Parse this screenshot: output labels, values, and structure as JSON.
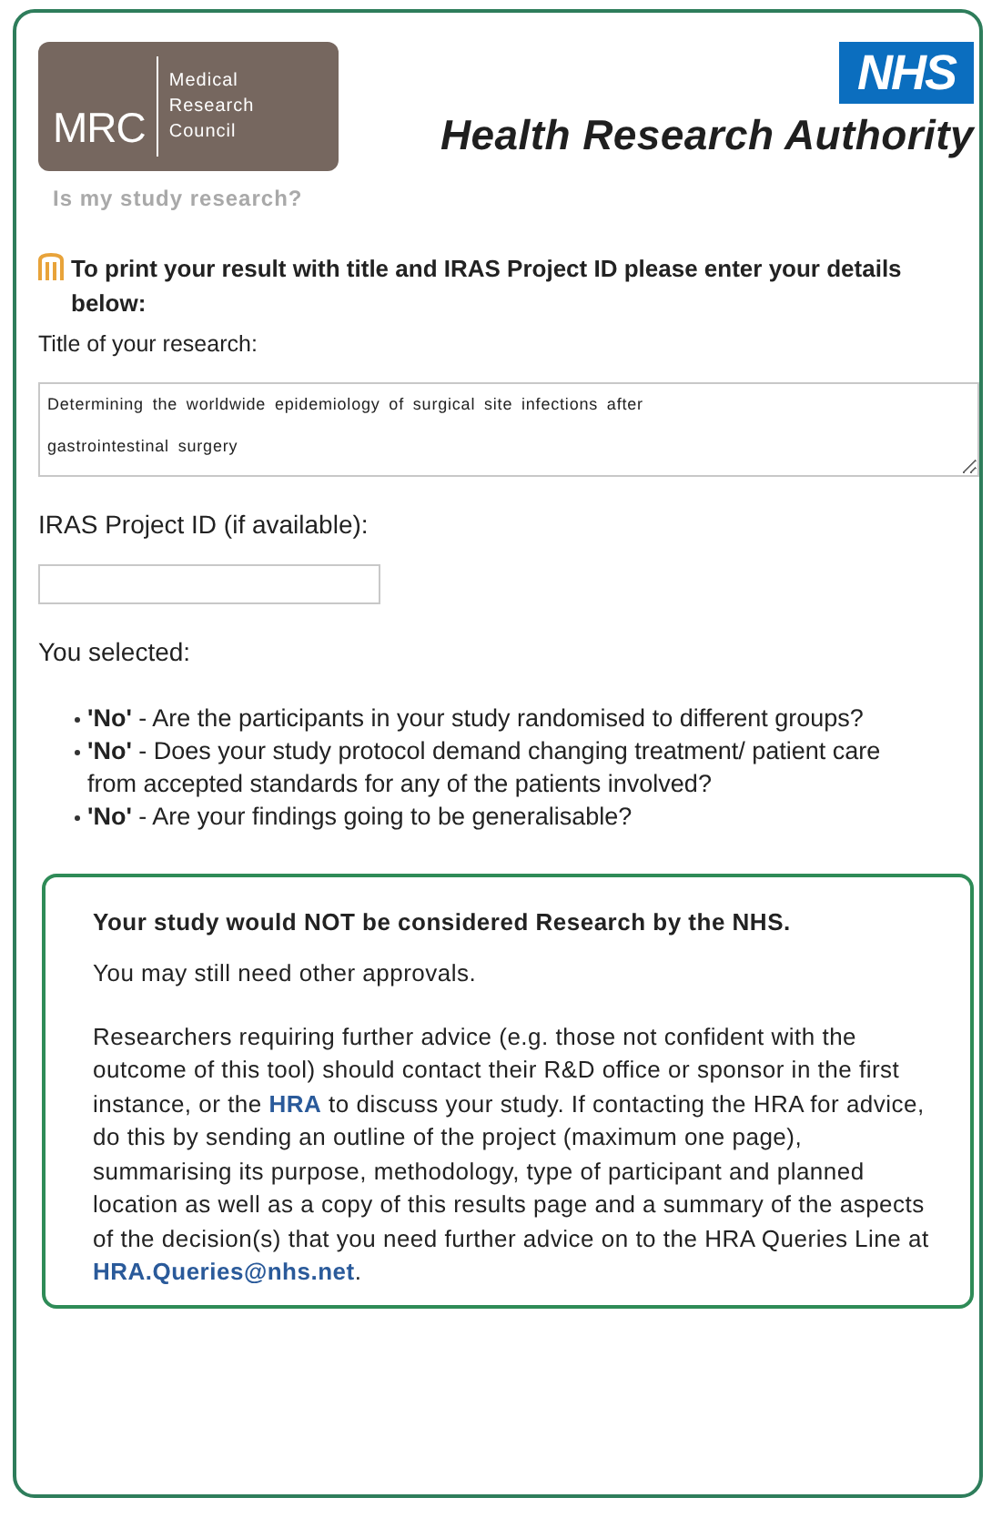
{
  "header": {
    "mrc_logo": {
      "abbr": "MRC",
      "lines": [
        "Medical",
        "Research",
        "Council"
      ]
    },
    "nhs_logo": "NHS",
    "authority": "Health Research Authority",
    "subtitle": "Is my study research?"
  },
  "form": {
    "intro": "To print your result with title and IRAS Project ID please enter your details below:",
    "title_label": "Title of your research:",
    "title_value": "Determining the worldwide epidemiology of surgical site infections after gastrointestinal surgery",
    "id_label": "IRAS Project ID (if available):",
    "selected_label": "You selected:",
    "answers": [
      {
        "answer": "'No'",
        "question": "- Are the participants in your study randomised to different groups?"
      },
      {
        "answer": "'No'",
        "question": "- Does your study protocol demand changing treatment/ patient care from accepted standards for any of the patients involved?"
      },
      {
        "answer": "'No'",
        "question": "- Are your findings going to be generalisable?"
      }
    ]
  },
  "result": {
    "heading": "Your study would NOT be considered Research by the NHS.",
    "note": "You may still need other approvals.",
    "advice": [
      {
        "kind": "text",
        "text": "Researchers requiring further advice (e.g. those not confident with the outcome of this tool) should contact their R&D office or sponsor in the first instance, or the "
      },
      {
        "kind": "link",
        "text": "HRA"
      },
      {
        "kind": "text",
        "text": " to discuss your study. If contacting the HRA for advice, do this by sending an outline of the project (maximum one page), summarising its purpose, methodology, type of participant and planned location as well as a copy of this results page and a summary of the aspects of the decision(s) that you need further advice on to the HRA Queries Line at "
      },
      {
        "kind": "link",
        "text": "HRA.Queries@nhs.net"
      },
      {
        "kind": "text",
        "text": "."
      }
    ]
  }
}
